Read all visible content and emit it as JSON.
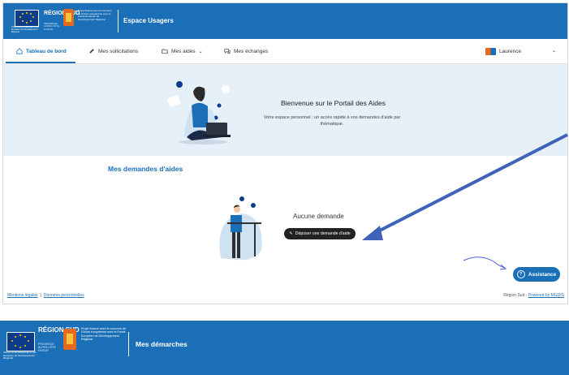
{
  "header": {
    "eu_caption": "UNION EUROPÉENNE Fonds Européen de Développement Régional",
    "region_title": "RÉGION SUD",
    "region_subtitle": "PROVENCE ALPES CÔTE D'AZUR",
    "project_text": "Projet financé avec le concours de l'Union européenne avec le Fonds Européen de Développement Régional",
    "app_title": "Espace Usagers"
  },
  "nav": {
    "items": [
      {
        "label": "Tableau de bord",
        "icon": "home-icon"
      },
      {
        "label": "Mes sollicitations",
        "icon": "pencil-icon"
      },
      {
        "label": "Mes aides",
        "icon": "folder-icon"
      },
      {
        "label": "Mes échanges",
        "icon": "chat-icon"
      }
    ],
    "user_name": "Laurence"
  },
  "hero": {
    "title": "Bienvenue sur le Portail des Aides",
    "description": "Votre espace personnel : un accès rapide à vos demandes d'aide par thématique."
  },
  "section": {
    "title": "Mes demandes d'aides",
    "empty_title": "Aucune demande",
    "deposit_button": "Déposer une demande d'aide"
  },
  "assistance": {
    "label": "Assistance"
  },
  "footer": {
    "legal": "Mentions légales",
    "separator": "|",
    "personal_data": "Données personnelles",
    "right_text": "Région Sud - ",
    "powered_by": "Powered by MGDIS"
  },
  "banner2": {
    "eu_caption": "UNION EUROPÉENNE Fonds Européen de Développement Régional",
    "region_title": "RÉGION SUD",
    "region_subtitle": "PROVENCE ALPES CÔTE D'AZUR",
    "project_text": "Projet financé avec le concours de l'Union européenne avec le Fonds Européen de Développement Régional",
    "title": "Mes démarches"
  },
  "colors": {
    "brand_blue": "#1a6fb7",
    "hero_bg": "#e6f0f8",
    "arrow_blue": "#3f63b8"
  }
}
